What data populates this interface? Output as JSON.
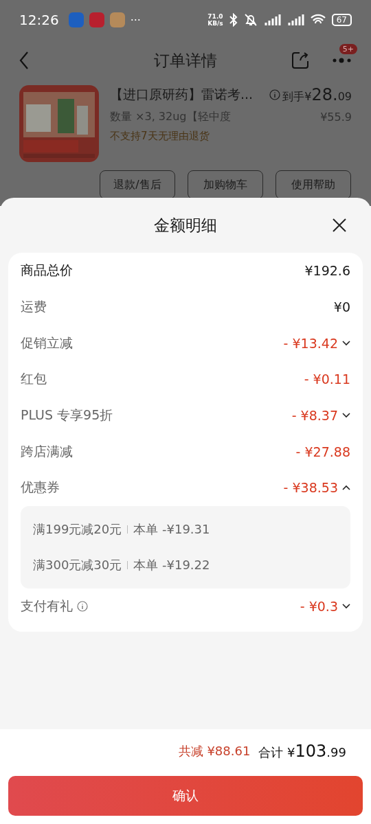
{
  "status_bar": {
    "time": "12:26",
    "more": "···",
    "speed_value": "71.0",
    "speed_unit": "KB/s",
    "battery": "67"
  },
  "header": {
    "title": "订单详情",
    "badge": "5+"
  },
  "product": {
    "title": "【进口原研药】雷诺考...",
    "price_label": "到手¥",
    "price_int": "28.",
    "price_dec": "09",
    "spec": "数量 ×3, 32ug【轻中度",
    "original_price": "¥55.9",
    "notice": "不支持7天无理由退货",
    "buttons": [
      "退款/售后",
      "加购物车",
      "使用帮助"
    ]
  },
  "sheet": {
    "title": "金额明细",
    "rows": [
      {
        "label": "商品总价",
        "value": "¥192.6",
        "kind": "total"
      },
      {
        "label": "运费",
        "value": "¥0",
        "kind": "plain"
      },
      {
        "label": "促销立减",
        "value": "- ¥13.42",
        "kind": "discount",
        "expanded": false
      },
      {
        "label": "红包",
        "value": "- ¥0.11",
        "kind": "discount"
      },
      {
        "label": "PLUS 专享95折",
        "value": "- ¥8.37",
        "kind": "discount",
        "expanded": false
      },
      {
        "label": "跨店满减",
        "value": "- ¥27.88",
        "kind": "discount"
      },
      {
        "label": "优惠券",
        "value": "- ¥38.53",
        "kind": "discount",
        "expanded": true,
        "children": [
          {
            "rule": "满199元减20元",
            "amount": "本单 -¥19.31"
          },
          {
            "rule": "满300元减30元",
            "amount": "本单 -¥19.22"
          }
        ]
      },
      {
        "label": "支付有礼",
        "value": "- ¥0.3",
        "kind": "discount",
        "expanded": false,
        "info": true
      }
    ]
  },
  "footer": {
    "saved_label": "共减",
    "saved_value": "¥88.61",
    "total_label": "合计",
    "total_currency": "¥",
    "total_int": "103",
    "total_dec": ".99",
    "confirm": "确认"
  }
}
